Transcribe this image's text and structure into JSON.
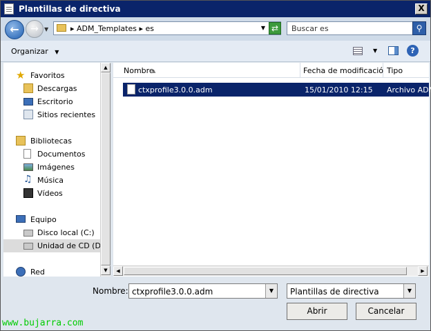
{
  "window": {
    "title": "Plantillas de directiva",
    "close_label": "X"
  },
  "address": {
    "path": [
      "ADM_Templates",
      "es"
    ],
    "separator": "▸",
    "search_placeholder": "Buscar es"
  },
  "toolbar": {
    "organize_label": "Organizar"
  },
  "nav": {
    "favorites": {
      "label": "Favoritos",
      "items": [
        "Descargas",
        "Escritorio",
        "Sitios recientes"
      ]
    },
    "libraries": {
      "label": "Bibliotecas",
      "items": [
        "Documentos",
        "Imágenes",
        "Música",
        "Vídeos"
      ]
    },
    "computer": {
      "label": "Equipo",
      "items": [
        "Disco local (C:)",
        "Unidad de CD (D:)"
      ]
    },
    "network": {
      "label": "Red"
    }
  },
  "columns": [
    "Nombre",
    "Fecha de modificación",
    "Tipo"
  ],
  "files": [
    {
      "name": "ctxprofile3.0.0.adm",
      "date": "15/01/2010 12:15",
      "type": "Archivo ADM"
    }
  ],
  "footer": {
    "name_label": "Nombre:",
    "name_value": "ctxprofile3.0.0.adm",
    "filter_value": "Plantillas de directiva",
    "open_label": "Abrir",
    "cancel_label": "Cancelar"
  },
  "watermark": "www.bujarra.com",
  "colors": {
    "selection": "#0a246a",
    "titlebar": "#0a246a",
    "watermark": "#00cc00"
  }
}
